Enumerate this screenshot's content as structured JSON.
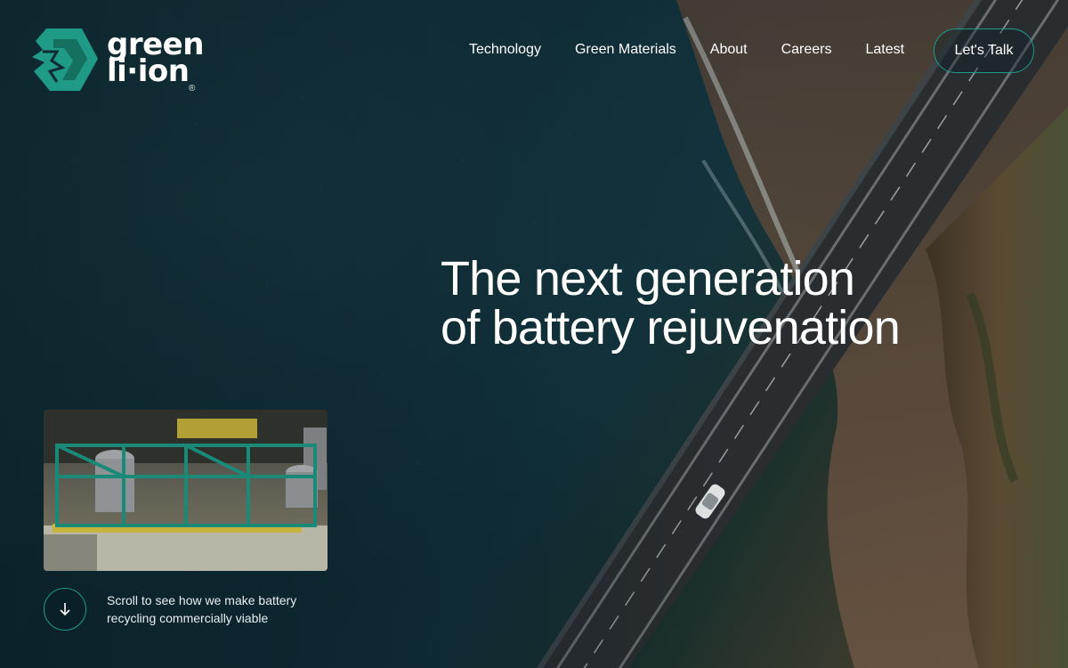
{
  "brand": {
    "name_line1": "green",
    "name_line2": "li·ion",
    "registered_mark": "®",
    "accent_color": "#1e9a86"
  },
  "nav": {
    "items": [
      {
        "label": "Technology"
      },
      {
        "label": "Green Materials"
      },
      {
        "label": "About"
      },
      {
        "label": "Careers"
      },
      {
        "label": "Latest"
      }
    ],
    "cta_label": "Let's Talk"
  },
  "hero": {
    "headline_line1": "The next generation",
    "headline_line2": "of battery rejuvenation"
  },
  "scroll": {
    "icon": "arrow-down-icon",
    "text": "Scroll to see how we make battery recycling commercially viable"
  }
}
